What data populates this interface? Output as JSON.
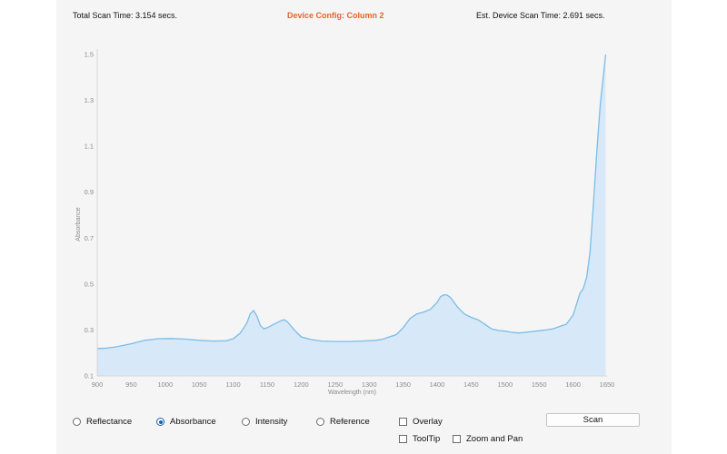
{
  "header": {
    "total_scan_time": "Total Scan Time: 3.154 secs.",
    "device_config": "Device Config: Column 2",
    "est_device_scan_time": "Est. Device Scan Time: 2.691 secs."
  },
  "controls": {
    "radios": [
      {
        "label": "Reflectance",
        "checked": false
      },
      {
        "label": "Absorbance",
        "checked": true
      },
      {
        "label": "Intensity",
        "checked": false
      },
      {
        "label": "Reference",
        "checked": false
      }
    ],
    "checkboxes": [
      {
        "label": "Overlay",
        "checked": false
      },
      {
        "label": "ToolTip",
        "checked": false
      },
      {
        "label": "Zoom and Pan",
        "checked": false
      }
    ],
    "scan_label": "Scan"
  },
  "colors": {
    "accent": "#e8622a",
    "line": "#7bbce8",
    "fill": "#d7e9f8",
    "radio_selected": "#1a5fb4"
  },
  "chart_data": {
    "type": "area",
    "title": "",
    "xlabel": "Wavelength (nm)",
    "ylabel": "Absorbance",
    "xlim": [
      900,
      1650
    ],
    "ylim": [
      0.1,
      1.5
    ],
    "x_ticks": [
      900,
      950,
      1000,
      1050,
      1100,
      1150,
      1200,
      1250,
      1300,
      1350,
      1400,
      1450,
      1500,
      1550,
      1600,
      1650
    ],
    "y_ticks": [
      0.1,
      0.3,
      0.5,
      0.7,
      0.9,
      1.1,
      1.3,
      1.5
    ],
    "y_tick_labels": [
      "0.1",
      "0.3",
      "0.5",
      "0.7",
      "0.9",
      "1.1",
      "1.3",
      "1.5"
    ],
    "grid": false,
    "series": [
      {
        "x": [
          900,
          910,
          925,
          950,
          970,
          990,
          1010,
          1030,
          1050,
          1070,
          1090,
          1100,
          1110,
          1120,
          1125,
          1130,
          1135,
          1140,
          1145,
          1150,
          1160,
          1170,
          1175,
          1180,
          1190,
          1200,
          1215,
          1230,
          1250,
          1270,
          1290,
          1310,
          1320,
          1330,
          1340,
          1350,
          1360,
          1370,
          1380,
          1390,
          1400,
          1405,
          1410,
          1415,
          1420,
          1430,
          1440,
          1450,
          1460,
          1470,
          1480,
          1490,
          1500,
          1510,
          1520,
          1530,
          1540,
          1550,
          1560,
          1570,
          1580,
          1590,
          1595,
          1600,
          1605,
          1610,
          1615,
          1620,
          1625,
          1630,
          1635,
          1640,
          1645,
          1648
        ],
        "y": [
          0.22,
          0.22,
          0.225,
          0.24,
          0.255,
          0.262,
          0.263,
          0.26,
          0.255,
          0.252,
          0.253,
          0.262,
          0.285,
          0.33,
          0.37,
          0.385,
          0.36,
          0.32,
          0.305,
          0.31,
          0.325,
          0.34,
          0.345,
          0.335,
          0.3,
          0.27,
          0.258,
          0.252,
          0.25,
          0.25,
          0.252,
          0.255,
          0.26,
          0.27,
          0.28,
          0.31,
          0.35,
          0.37,
          0.378,
          0.39,
          0.42,
          0.445,
          0.453,
          0.452,
          0.44,
          0.4,
          0.37,
          0.355,
          0.345,
          0.325,
          0.305,
          0.298,
          0.295,
          0.29,
          0.287,
          0.29,
          0.293,
          0.297,
          0.3,
          0.305,
          0.315,
          0.325,
          0.345,
          0.365,
          0.41,
          0.46,
          0.48,
          0.53,
          0.64,
          0.85,
          1.08,
          1.28,
          1.42,
          1.5
        ]
      }
    ]
  }
}
